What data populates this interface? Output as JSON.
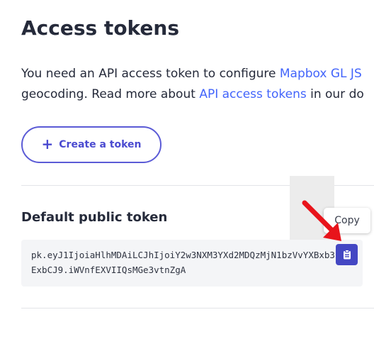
{
  "page": {
    "title": "Access tokens",
    "intro": {
      "line1_text": "You need an API access token to configure ",
      "line1_link": "Mapbox GL JS",
      "line2_text1": "geocoding. Read more about ",
      "line2_link": "API access tokens",
      "line2_text2": " in our do"
    }
  },
  "actions": {
    "create_token_label": "Create a token",
    "create_token_icon": "plus-icon"
  },
  "default_token": {
    "label": "Default public token",
    "value": "pk.eyJ1IjoiaHlhMDAiLCJhIjoiY2w3NXM3YXd2MDQzMjN1bzVvYXBxb3ExbCJ9.iWVnfEXVIIQsMGe3vtnZgA",
    "copy_icon": "clipboard-icon",
    "copy_tooltip": "Copy"
  },
  "annotation": {
    "arrow_icon": "red-arrow-icon",
    "arrow_color": "#e8141b"
  },
  "colors": {
    "accent": "#4447c3",
    "link": "#4264fb",
    "button_border": "#5b5bd6"
  }
}
